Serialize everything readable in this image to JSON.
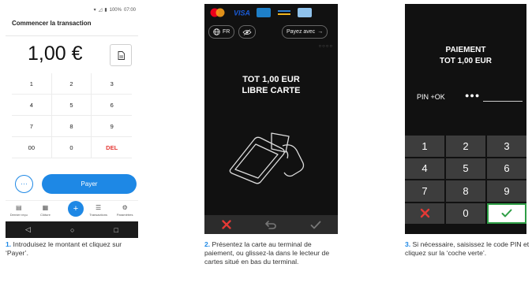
{
  "panel1": {
    "status": {
      "battery": "100%",
      "time": "07:00"
    },
    "title": "Commencer la transaction",
    "amount": "1,00 €",
    "keypad": [
      "1",
      "2",
      "3",
      "4",
      "5",
      "6",
      "7",
      "8",
      "9",
      "00",
      "0",
      "DEL"
    ],
    "more_label": "···",
    "pay_label": "Payer",
    "nav": [
      {
        "label": "Dernier reçu",
        "icon": "receipt-icon"
      },
      {
        "label": "Clôture",
        "icon": "calendar-icon"
      },
      {
        "label": "Transactions",
        "icon": "list-icon"
      },
      {
        "label": "Paramètres",
        "icon": "gear-icon"
      }
    ],
    "fab_label": "+",
    "android_nav": [
      "◁",
      "○",
      "□"
    ]
  },
  "panel2": {
    "lang_label": "FR",
    "payez_label": "Payez avec",
    "dots": "○○○○",
    "msg_line1": "TOT 1,00 EUR",
    "msg_line2": "LIBRE CARTE"
  },
  "panel3": {
    "title_line1": "PAIEMENT",
    "title_line2": "TOT 1,00 EUR",
    "pin_label": "PIN +OK",
    "pin_dots": "●●●",
    "keypad": [
      "1",
      "2",
      "3",
      "4",
      "5",
      "6",
      "7",
      "8",
      "9",
      "✕",
      "0",
      "✓"
    ]
  },
  "captions": [
    {
      "num": "1.",
      "text": " Introduisez le montant et cliquez sur ‘Payer’."
    },
    {
      "num": "2.",
      "text": " Présentez la carte au terminal de paiement, ou glissez-la dans le lecteur de cartes situé en bas du terminal."
    },
    {
      "num": "3.",
      "text": " Si nécessaire, saisissez le code PIN et cliquez sur la ‘coche verte’."
    }
  ],
  "colors": {
    "accent": "#1e88e5",
    "cancel": "#e53935",
    "confirm": "#2e9e45",
    "terminal_bg": "#111111"
  }
}
